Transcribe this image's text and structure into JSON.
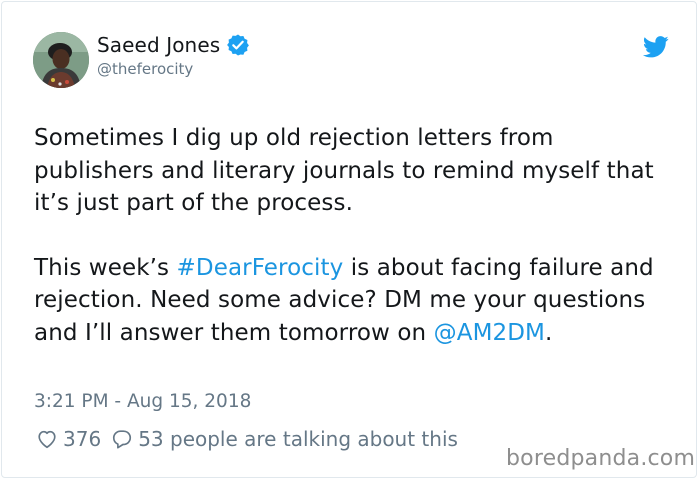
{
  "author": {
    "name": "Saeed Jones",
    "handle": "@theferocity",
    "verified": true
  },
  "tweet": {
    "para1": "Sometimes I dig up old rejection letters from publishers and literary journals to remind myself that it’s just part of the process.",
    "para2_before_hashtag": "This week’s ",
    "hashtag": "#DearFerocity",
    "para2_after_hashtag": " is about facing failure and rejection. Need some advice? DM me your questions and I’ll answer them tomorrow on ",
    "mention": "@AM2DM",
    "para2_end": "."
  },
  "timestamp": "3:21 PM - Aug 15, 2018",
  "stats": {
    "likes": "376",
    "replies_text": "53 people are talking about this"
  },
  "watermark": "boredpanda.com",
  "colors": {
    "link": "#1b95e0",
    "verified_badge": "#1da1f2",
    "twitter_bird": "#1da1f2",
    "secondary_text": "#657786"
  },
  "icons": [
    "verified-badge-icon",
    "twitter-bird-icon",
    "heart-icon",
    "reply-bubble-icon"
  ]
}
